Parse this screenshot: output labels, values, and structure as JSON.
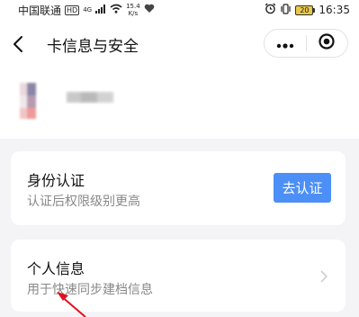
{
  "status_bar": {
    "carrier": "中国联通",
    "hd_badge": "HD",
    "network": "4G",
    "speed_value": "15.4",
    "speed_unit": "K/s",
    "battery": "20",
    "time": "16:35"
  },
  "nav": {
    "title": "卡信息与安全"
  },
  "identity_card": {
    "title": "身份认证",
    "subtitle": "认证后权限级别更高",
    "button_label": "去认证"
  },
  "personal_card": {
    "title": "个人信息",
    "subtitle": "用于快速同步建档信息"
  },
  "colors": {
    "accent": "#4c8ff6",
    "annotation_arrow": "#e0101e"
  }
}
